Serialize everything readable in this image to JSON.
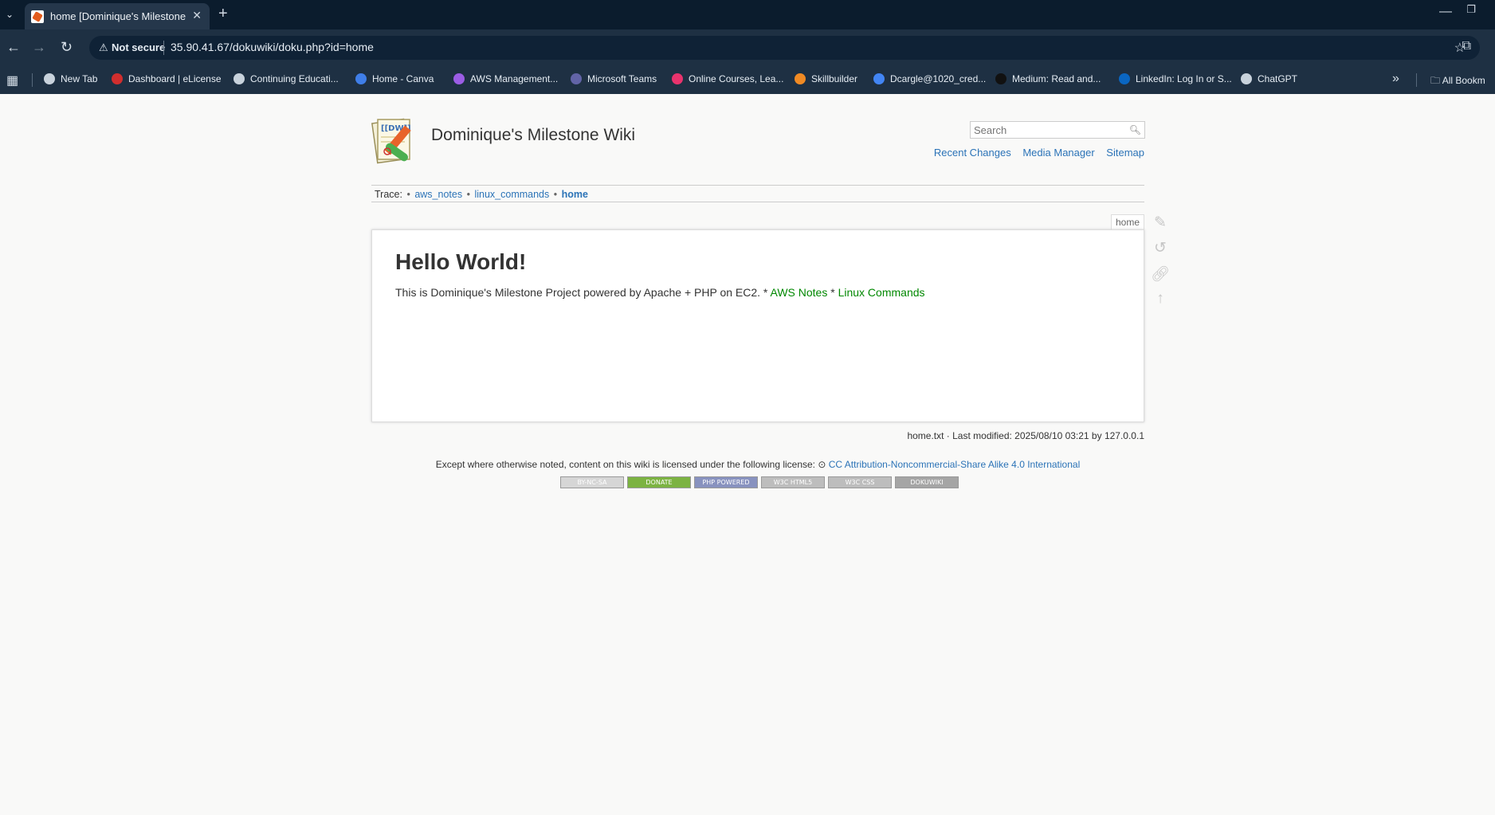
{
  "browser": {
    "tab_title": "home [Dominique's Milestone W",
    "security_label": "Not secure",
    "url": "35.90.41.67/dokuwiki/doku.php?id=home",
    "bookmarks": [
      {
        "label": "New Tab",
        "color": "#c8d2dc"
      },
      {
        "label": "Dashboard | eLicense",
        "color": "#d12e2e"
      },
      {
        "label": "Continuing Educati...",
        "color": "#c8d2dc"
      },
      {
        "label": "Home - Canva",
        "color": "#3f7ee8"
      },
      {
        "label": "AWS Management...",
        "color": "#9b5de5"
      },
      {
        "label": "Microsoft Teams",
        "color": "#6264a7"
      },
      {
        "label": "Online Courses, Lea...",
        "color": "#e8336d"
      },
      {
        "label": "Skillbuilder",
        "color": "#f08a24"
      },
      {
        "label": "Dcargle@1020_cred...",
        "color": "#4285f4"
      },
      {
        "label": "Medium: Read and...",
        "color": "#111111"
      },
      {
        "label": "LinkedIn: Log In or S...",
        "color": "#0a66c2"
      },
      {
        "label": "ChatGPT",
        "color": "#c8d2dc"
      }
    ],
    "all_bookmarks": "All Bookm"
  },
  "wiki": {
    "title": "Dominique's Milestone Wiki",
    "search_placeholder": "Search",
    "tools": [
      "Recent Changes",
      "Media Manager",
      "Sitemap"
    ],
    "trace_label": "Trace:",
    "trace": [
      "aws_notes",
      "linux_commands",
      "home"
    ],
    "page_id": "home",
    "heading": "Hello World!",
    "body_text": "This is Dominique's Milestone Project powered by Apache + PHP on EC2. * ",
    "link1": "AWS Notes",
    "sep": " * ",
    "link2": "Linux Commands",
    "docinfo": "home.txt · Last modified: 2025/08/10 03:21 by 127.0.0.1",
    "license_text": "Except where otherwise noted, content on this wiki is licensed under the following license: ",
    "license_link": "CC Attribution-Noncommercial-Share Alike 4.0 International",
    "badges": [
      "BY-NC-SA",
      "DONATE",
      "PHP POWERED",
      "W3C HTML5",
      "W3C CSS",
      "DOKUWIKI"
    ]
  }
}
